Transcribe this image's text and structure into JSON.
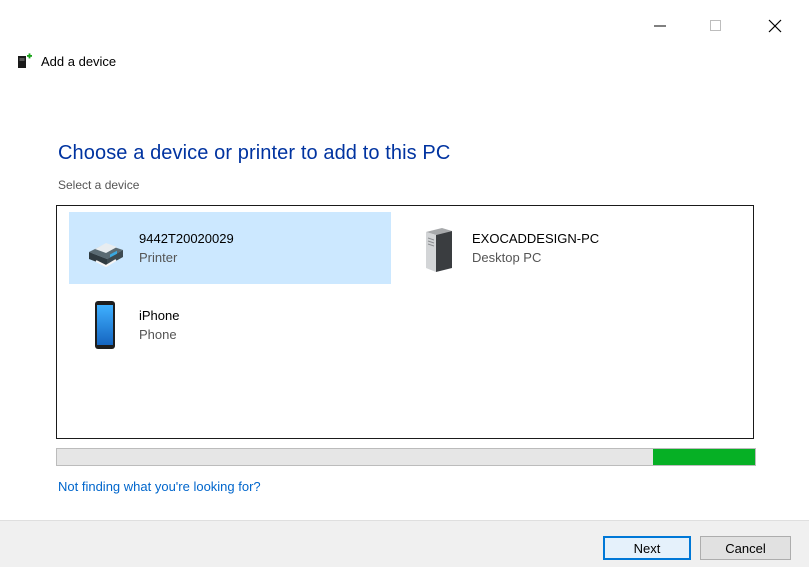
{
  "window": {
    "title": "Add a device",
    "controls": [
      "minimize",
      "maximize",
      "close"
    ]
  },
  "main": {
    "heading": "Choose a device or printer to add to this PC",
    "subheading": "Select a device"
  },
  "devices": [
    {
      "name": "9442T20020029",
      "type": "Printer",
      "icon": "printer-icon",
      "selected": true
    },
    {
      "name": "EXOCADDESIGN-PC",
      "type": "Desktop PC",
      "icon": "desktop-pc-icon",
      "selected": false
    },
    {
      "name": "iPhone",
      "type": "Phone",
      "icon": "phone-icon",
      "selected": false
    }
  ],
  "progress": {
    "indeterminate": true,
    "fill_start": 0.854,
    "fill_end": 1.0,
    "color": "#06b025"
  },
  "help_link": "Not finding what you're looking for?",
  "buttons": {
    "next": "Next",
    "cancel": "Cancel"
  },
  "colors": {
    "accent": "#0078d7",
    "heading": "#0033a0",
    "selection": "#cce8ff",
    "link": "#0066cc"
  }
}
